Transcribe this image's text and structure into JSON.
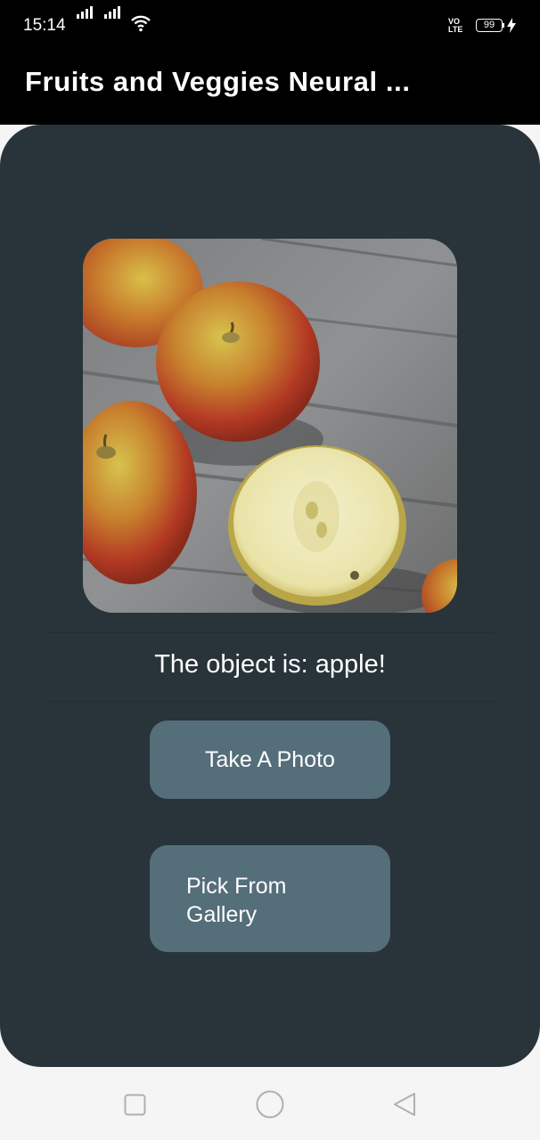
{
  "status_bar": {
    "time": "15:14",
    "network_label": "VO\nLTE",
    "battery_level": "99"
  },
  "app_bar": {
    "title": "Fruits and Veggies Neural ..."
  },
  "prediction": {
    "result_text": "The object is: apple!"
  },
  "buttons": {
    "take_photo": "Take A Photo",
    "pick_gallery": "Pick From Gallery"
  },
  "colors": {
    "card_background": "#29333a",
    "button_background": "#546e7a",
    "app_bar": "#000000"
  }
}
